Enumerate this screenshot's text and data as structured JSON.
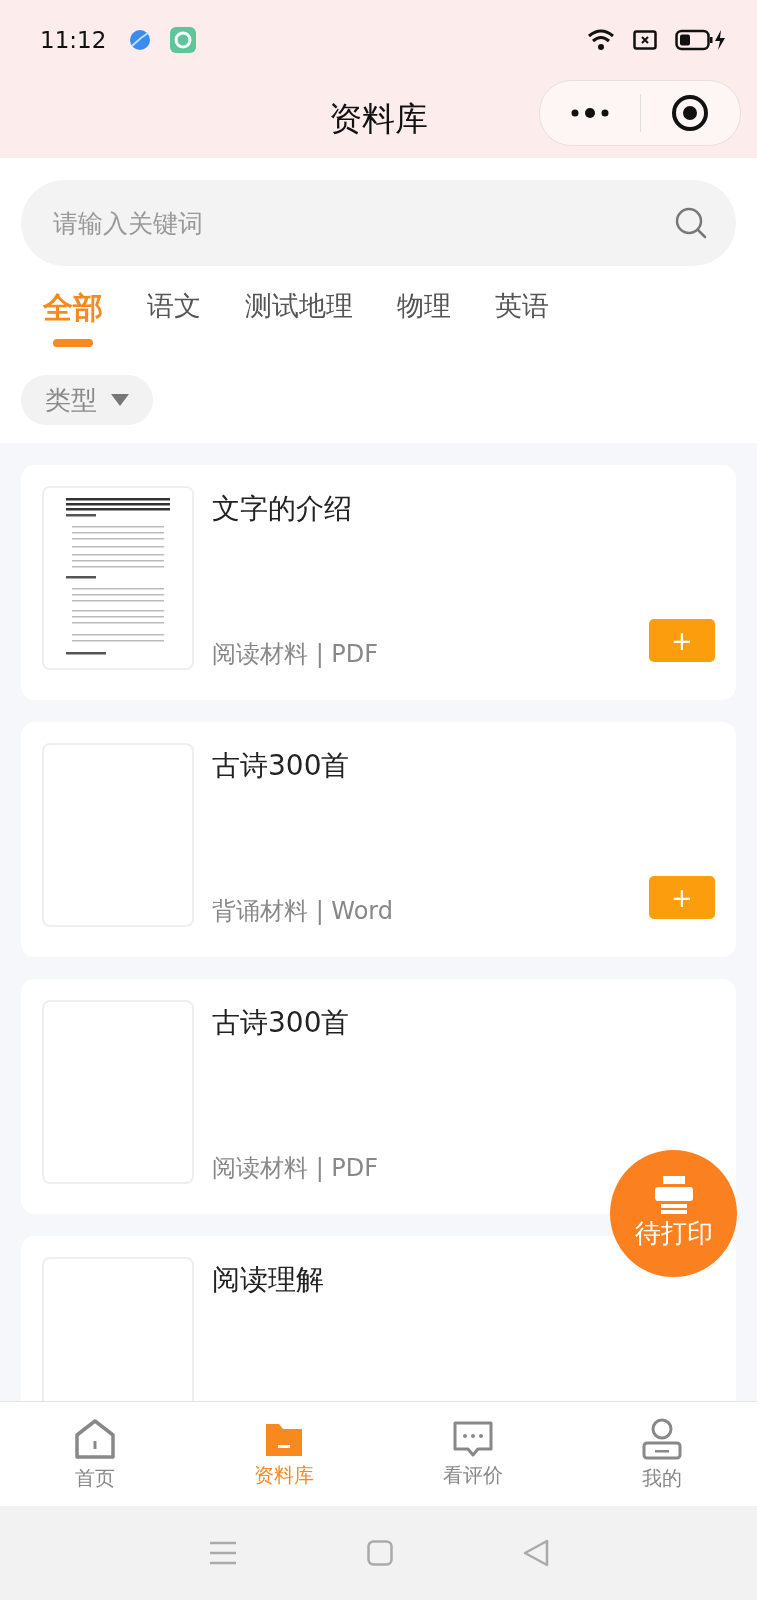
{
  "status_bar": {
    "time": "11:12"
  },
  "header": {
    "title": "资料库"
  },
  "search": {
    "placeholder": "请输入关键词"
  },
  "tabs": [
    {
      "label": "全部",
      "selected": true
    },
    {
      "label": "语文",
      "selected": false
    },
    {
      "label": "测试地理",
      "selected": false
    },
    {
      "label": "物理",
      "selected": false
    },
    {
      "label": "英语",
      "selected": false
    }
  ],
  "filter": {
    "label": "类型"
  },
  "cards": [
    {
      "title": "文字的介绍",
      "meta": "阅读材料 | PDF",
      "add_button": {
        "label": "+"
      }
    },
    {
      "title": "古诗300首",
      "meta": "背诵材料 | Word",
      "add_button": {
        "label": "+"
      }
    },
    {
      "title": "古诗300首",
      "meta": "阅读材料 | PDF"
    },
    {
      "title": "阅读理解"
    }
  ],
  "float_button": {
    "label": "待打印"
  },
  "bottom_nav": [
    {
      "label": "首页",
      "selected": false
    },
    {
      "label": "资料库",
      "selected": true
    },
    {
      "label": "看评价",
      "selected": false
    },
    {
      "label": "我的",
      "selected": false
    }
  ]
}
